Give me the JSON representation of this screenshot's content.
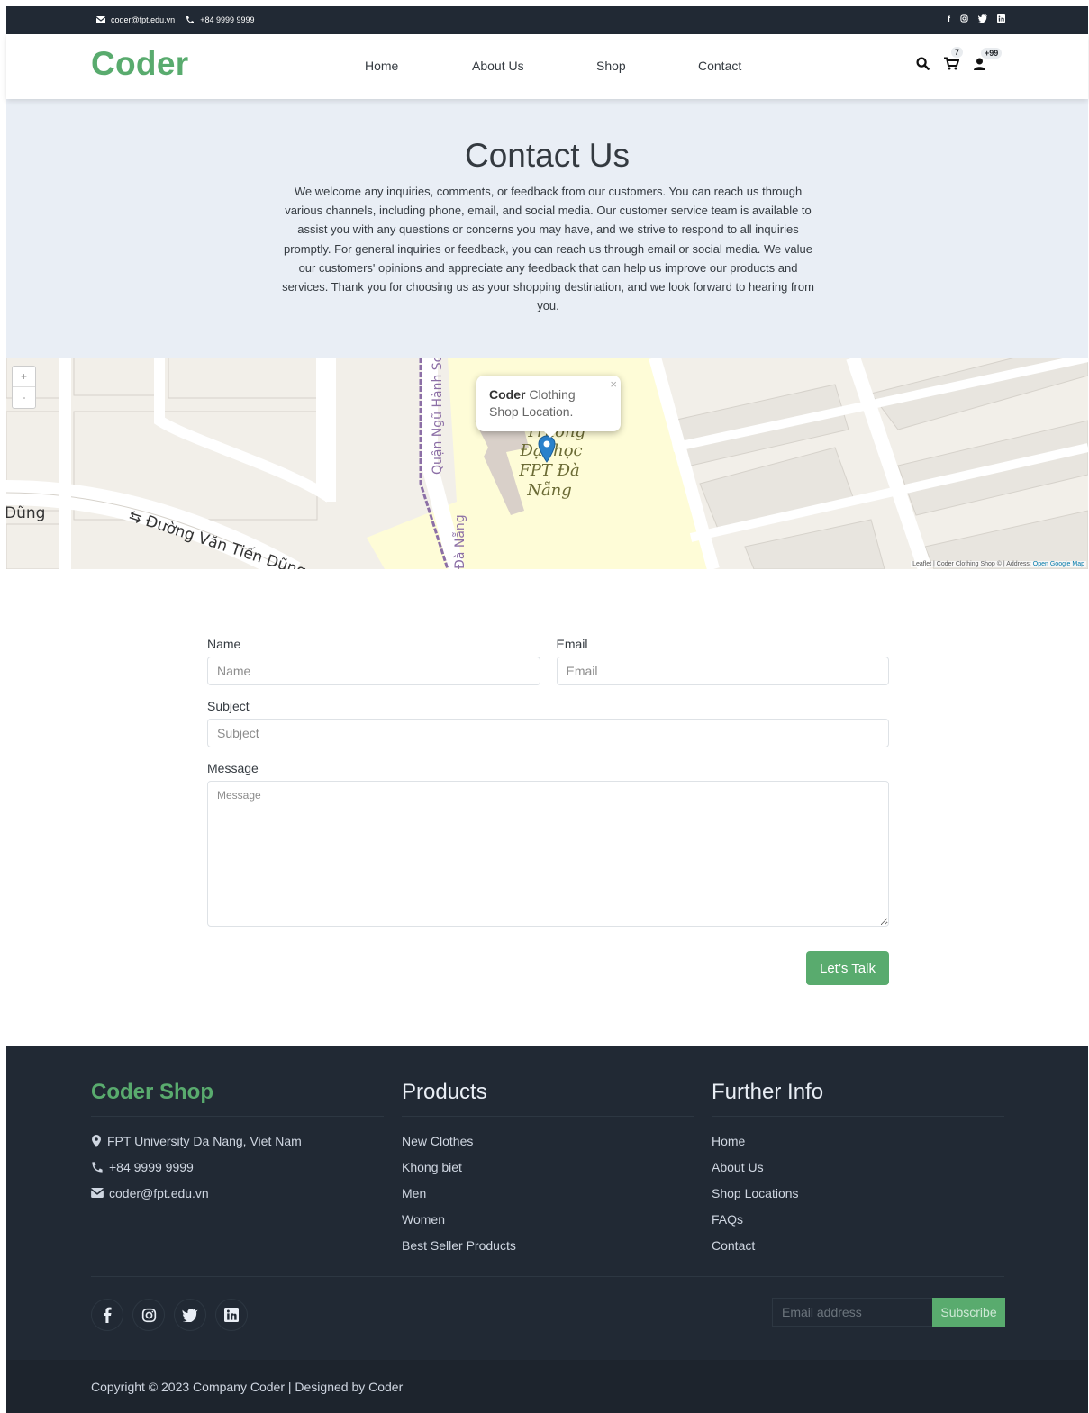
{
  "topbar": {
    "email": "coder@fpt.edu.vn",
    "phone": "+84 9999 9999",
    "socials": [
      "facebook-icon",
      "instagram-icon",
      "twitter-icon",
      "linkedin-icon"
    ]
  },
  "nav": {
    "logo": "Coder",
    "menu": [
      "Home",
      "About Us",
      "Shop",
      "Contact"
    ],
    "cart_count": "7",
    "user_count": "+99"
  },
  "hero": {
    "title": "Contact Us",
    "text": "We welcome any inquiries, comments, or feedback from our customers. You can reach us through various channels, including phone, email, and social media. Our customer service team is available to assist you with any questions or concerns you may have, and we strive to respond to all inquiries promptly. For general inquiries or feedback, you can reach us through email or social media. We value our customers' opinions and appreciate any feedback that can help us improve our products and services. Thank you for choosing us as your shopping destination, and we look forward to hearing from you."
  },
  "map": {
    "zoom_in": "+",
    "zoom_out": "-",
    "popup_bold": "Coder",
    "popup_text": " Clothing Shop Location.",
    "labels": [
      "Đường Văn Tiến Dũng",
      "Quận Ngũ Hành Sơn",
      "Trường Đại học FPT Đà Nẵng",
      "Đà Nẵng",
      "Dũng"
    ],
    "attribution": "Leaflet | Coder Clothing Shop © | Address: ",
    "attribution_link": "Open Google Map"
  },
  "form": {
    "name_label": "Name",
    "name_placeholder": "Name",
    "email_label": "Email",
    "email_placeholder": "Email",
    "subject_label": "Subject",
    "subject_placeholder": "Subject",
    "message_label": "Message",
    "message_placeholder": "Message",
    "submit": "Let’s Talk"
  },
  "footer": {
    "brand": "Coder Shop",
    "address": "FPT University Da Nang, Viet Nam",
    "phone": "+84 9999 9999",
    "email": "coder@fpt.edu.vn",
    "products_title": "Products",
    "products": [
      "New Clothes",
      "Khong biet",
      "Men",
      "Women",
      "Best Seller Products"
    ],
    "info_title": "Further Info",
    "info": [
      "Home",
      "About Us",
      "Shop Locations",
      "FAQs",
      "Contact"
    ],
    "subscribe_placeholder": "Email address",
    "subscribe_button": "Subscribe",
    "copyright": "Copyright © 2023 Company Coder | Designed by Coder"
  }
}
